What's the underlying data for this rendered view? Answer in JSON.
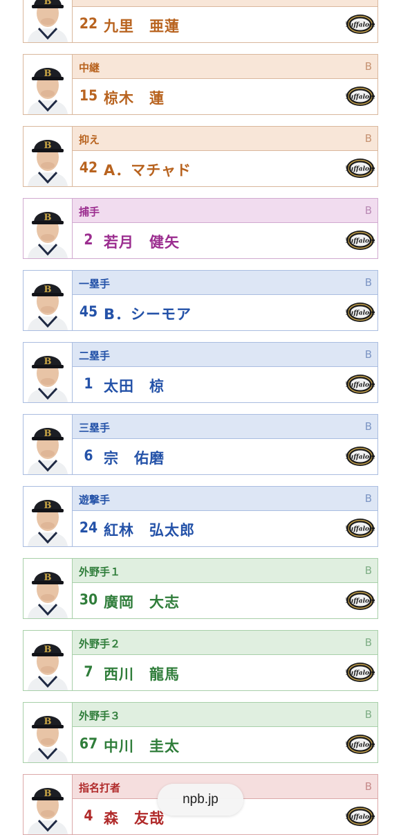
{
  "players": [
    {
      "position": "",
      "team": "",
      "number": "22",
      "name": "九里　亜蓮",
      "theme": "pitcher",
      "partial": true
    },
    {
      "position": "中継",
      "team": "B",
      "number": "15",
      "name": "椋木　蓮",
      "theme": "pitcher"
    },
    {
      "position": "抑え",
      "team": "B",
      "number": "42",
      "name": "A．マチャド",
      "theme": "pitcher"
    },
    {
      "position": "捕手",
      "team": "B",
      "number": "2",
      "name": "若月　健矢",
      "theme": "catcher"
    },
    {
      "position": "一塁手",
      "team": "B",
      "number": "45",
      "name": "B．シーモア",
      "theme": "infield"
    },
    {
      "position": "二塁手",
      "team": "B",
      "number": "1",
      "name": "太田　椋",
      "theme": "infield"
    },
    {
      "position": "三塁手",
      "team": "B",
      "number": "6",
      "name": "宗　佑磨",
      "theme": "infield"
    },
    {
      "position": "遊撃手",
      "team": "B",
      "number": "24",
      "name": "紅林　弘太郎",
      "theme": "infield"
    },
    {
      "position": "外野手１",
      "team": "B",
      "number": "30",
      "name": "廣岡　大志",
      "theme": "outfield"
    },
    {
      "position": "外野手２",
      "team": "B",
      "number": "7",
      "name": "西川　龍馬",
      "theme": "outfield"
    },
    {
      "position": "外野手３",
      "team": "B",
      "number": "67",
      "name": "中川　圭太",
      "theme": "outfield"
    },
    {
      "position": "指名打者",
      "team": "B",
      "number": "4",
      "name": "森　友哉",
      "theme": "dh"
    }
  ],
  "team_logo_icon": "buffaloes-logo-icon",
  "player_photo_icon": "player-photo-icon",
  "source_badge": "npb.jp"
}
